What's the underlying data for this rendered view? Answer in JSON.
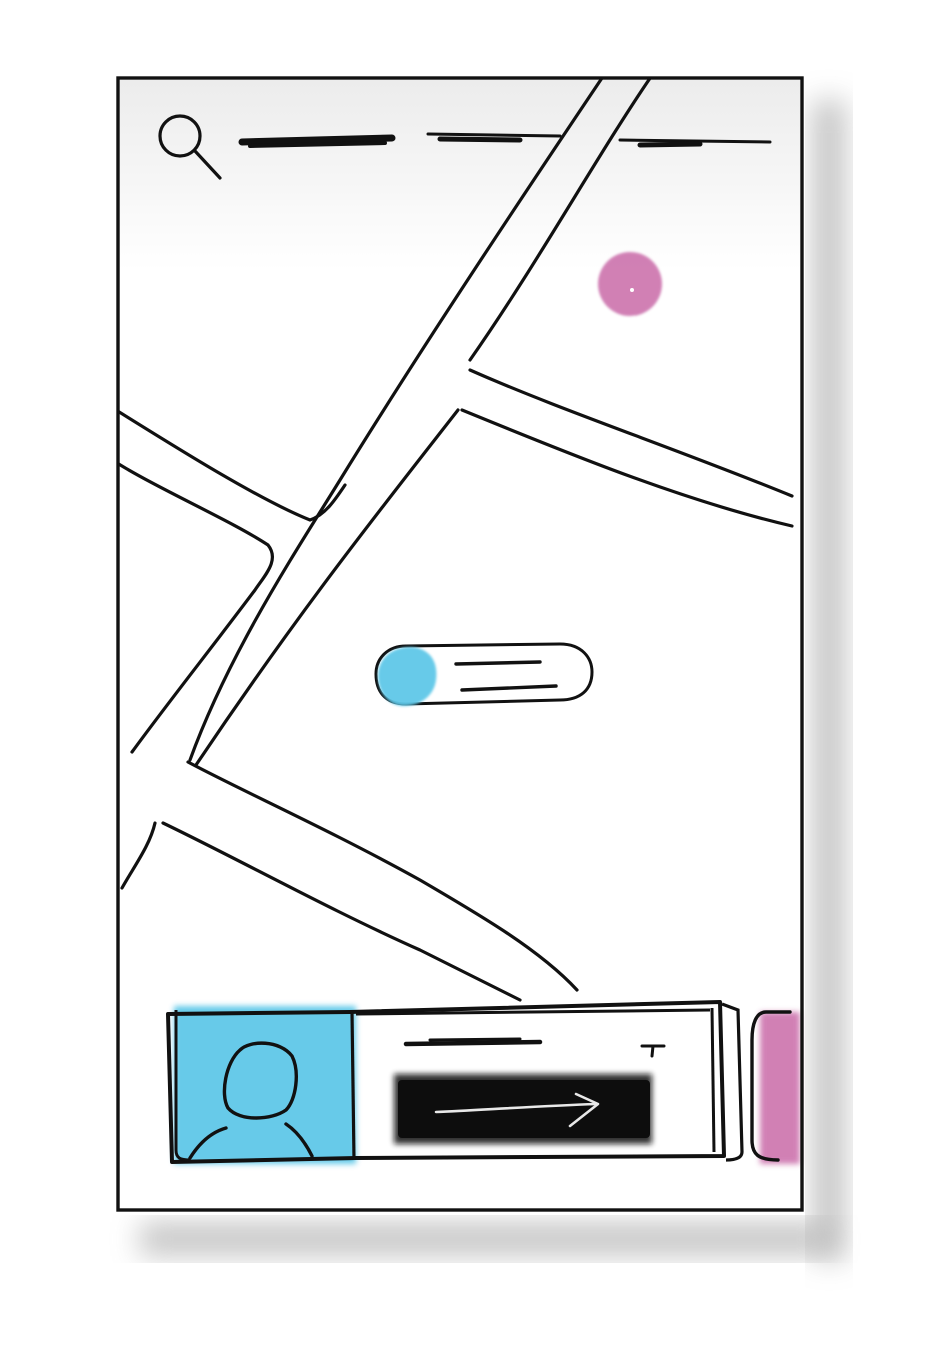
{
  "colors": {
    "ink": "#111111",
    "accent_blue": "#5ec8e8",
    "accent_pink": "#c96aa8",
    "shadow": "#b4b4b4",
    "header_fade": "#ececec",
    "dark_button": "#0d0d0d",
    "arrow": "#e8e8e8"
  },
  "search": {
    "icon": "search-icon",
    "placeholder_scribble_segments": 3
  },
  "map": {
    "poi_marker": {
      "color": "accent_pink"
    },
    "location_callout": {
      "avatar_color": "accent_blue",
      "text_lines": 2
    }
  },
  "bottom_card": {
    "avatar_icon": "user-icon",
    "avatar_color": "accent_blue",
    "title_scribble": true,
    "action_button": {
      "icon": "arrow-right-icon"
    },
    "next_card_peek_color": "accent_pink"
  }
}
